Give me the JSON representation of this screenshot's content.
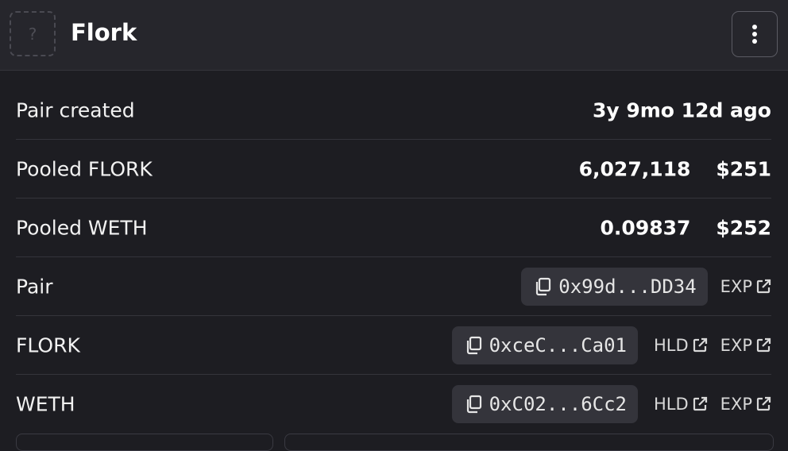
{
  "header": {
    "logo_placeholder": "?",
    "title": "Flork"
  },
  "rows": {
    "pair_created": {
      "label": "Pair created",
      "value": "3y 9mo 12d ago"
    },
    "pooled_base": {
      "label": "Pooled FLORK",
      "amount": "6,027,118",
      "usd": "$251"
    },
    "pooled_quote": {
      "label": "Pooled WETH",
      "amount": "0.09837",
      "usd": "$252"
    },
    "pair": {
      "label": "Pair",
      "address": "0x99d...DD34",
      "exp": "EXP"
    },
    "base_token": {
      "label": "FLORK",
      "address": "0xceC...Ca01",
      "hld": "HLD",
      "exp": "EXP"
    },
    "quote_token": {
      "label": "WETH",
      "address": "0xC02...6Cc2",
      "hld": "HLD",
      "exp": "EXP"
    }
  },
  "colors": {
    "background": "#1d1d22",
    "header_bg": "#26262c",
    "chip_bg": "#34343b",
    "divider": "#34343b"
  },
  "icons": [
    "kebab-menu-icon",
    "copy-icon",
    "external-link-icon"
  ]
}
